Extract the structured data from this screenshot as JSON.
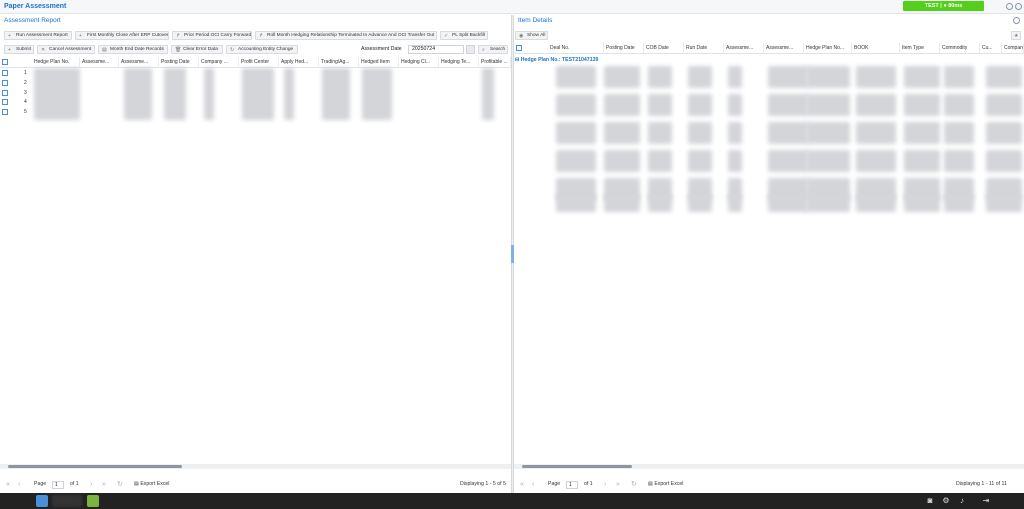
{
  "app": {
    "title": "Paper Assessment",
    "env_badge": "TEST | ● 80ms"
  },
  "left_panel": {
    "title": "Assessment Report",
    "toolbar_row1": [
      {
        "icon": "+",
        "label": "Run Assessment Report"
      },
      {
        "icon": "+",
        "label": "First Monthly Close After ERP Cutover"
      },
      {
        "icon": "↱",
        "label": "Prior Period OCI Carry Forward"
      },
      {
        "icon": "↱",
        "label": "Roll Month Hedging Relationship Terminated In Advance And OCI Transfer Out"
      },
      {
        "icon": "✓",
        "label": "PL Split Backfill"
      }
    ],
    "toolbar_row2": [
      {
        "icon": "+",
        "label": "Submit"
      },
      {
        "icon": "✕",
        "label": "Cancel Assessment"
      },
      {
        "icon": "▤",
        "label": "Month End Date Records"
      },
      {
        "icon": "🗑",
        "label": "Clear Error Data"
      },
      {
        "icon": "↻",
        "label": "Accounting Entity Change"
      }
    ],
    "assessment_date_label": "Assessment Date",
    "assessment_date_value": "20250724",
    "search_label": "Search",
    "columns": [
      "Hedge Plan No.",
      "Assessme...",
      "Assessme...",
      "Posting Date",
      "Company ...",
      "Profit Center",
      "Apply Hed...",
      "Trading/Ag...",
      "Hedged Item",
      "Hedging Cl...",
      "Hedging Te...",
      "Profitable ..."
    ],
    "row_numbers": [
      "1",
      "2",
      "3",
      "4",
      "5"
    ],
    "pager": {
      "page_label": "Page",
      "page_value": "1",
      "of_label": "of 1",
      "export_label": "Export Excel",
      "displaying": "Displaying 1 - 5 of 5"
    }
  },
  "right_panel": {
    "title": "Item Details",
    "show_all_label": "Show All",
    "columns": [
      "Deal No.",
      "Posting Date",
      "COB Date",
      "Run Date",
      "Assessme...",
      "Assessme...",
      "Hedge Plan No...",
      "BOOK",
      "Item Type",
      "Commodity",
      "Cu...",
      "Compan..."
    ],
    "group_label": "Hedge Plan No.: TEST21047139",
    "pager": {
      "page_label": "Page",
      "page_value": "1",
      "of_label": "of 1",
      "export_label": "Export Excel",
      "displaying": "Displaying 1 - 11 of 11"
    }
  },
  "colors": {
    "accent": "#1a73c9",
    "env_badge": "#52d01a",
    "taskbar": "#222222"
  }
}
